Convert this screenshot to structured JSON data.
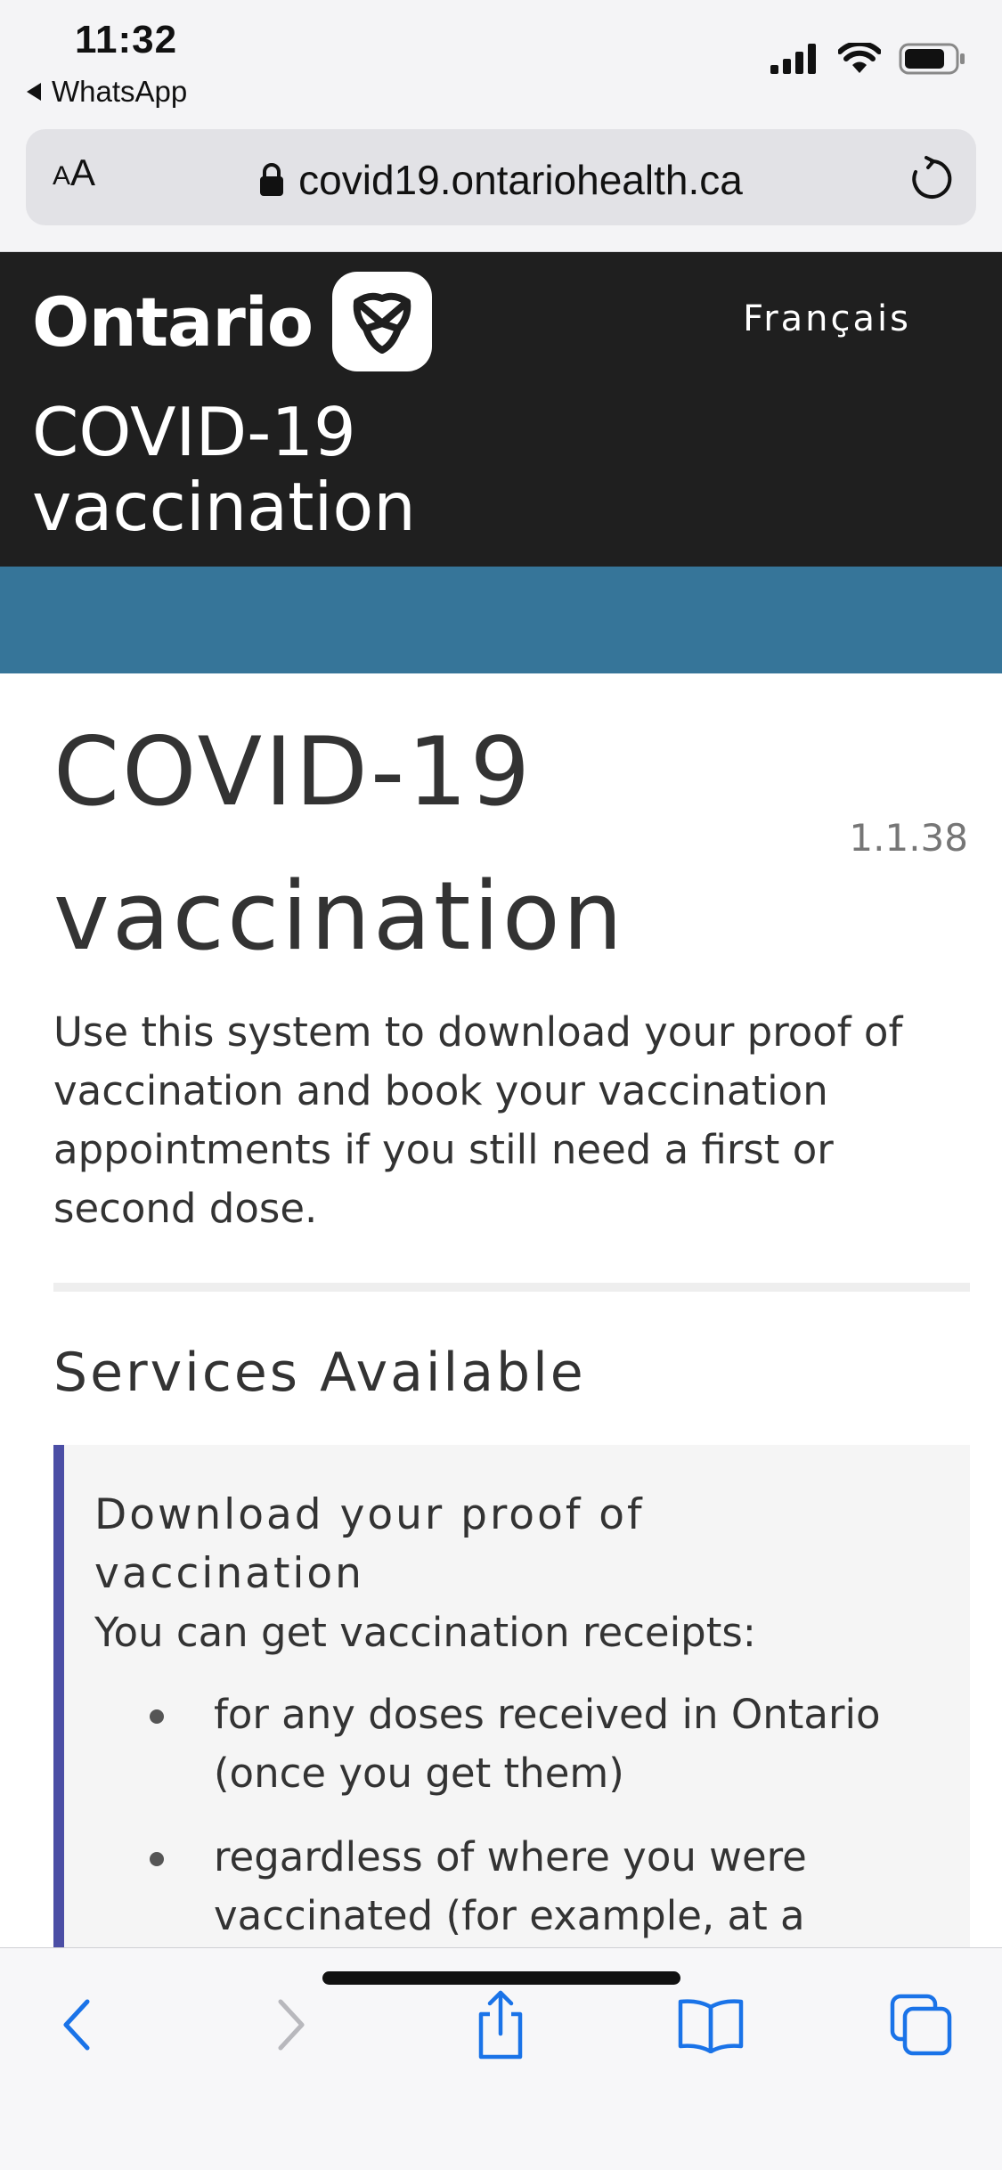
{
  "status_bar": {
    "time": "11:32",
    "back_app": "WhatsApp"
  },
  "browser": {
    "text_size_small": "A",
    "text_size_large": "A",
    "url": "covid19.ontariohealth.ca"
  },
  "header": {
    "logo_text": "Ontario",
    "language_link": "Français",
    "subtitle_line1": "COVID-19",
    "subtitle_line2": "vaccination"
  },
  "main": {
    "title_line1": "COVID-19",
    "title_line2": "vaccination",
    "version": "1.1.38",
    "intro": "Use this system to download your proof of vaccination and book your vaccination appointments if you still need a first or second dose.",
    "services_heading": "Services Available",
    "card": {
      "title": "Download your proof of vaccination",
      "description": "You can get vaccination receipts:",
      "items": [
        "for any doses received in Ontario (once you get them)",
        "regardless of where you were vaccinated (for example, at a"
      ]
    }
  },
  "colors": {
    "header_bg": "#1f1f1f",
    "accent_band": "#367599",
    "card_border": "#4b4ea5",
    "ios_blue": "#1a73e8"
  },
  "icons": {
    "lock": "lock-icon",
    "reload": "reload-icon",
    "back": "chevron-left-icon",
    "forward": "chevron-right-icon",
    "share": "share-icon",
    "bookmarks": "book-icon",
    "tabs": "tabs-icon",
    "trillium": "trillium-logo-icon"
  }
}
